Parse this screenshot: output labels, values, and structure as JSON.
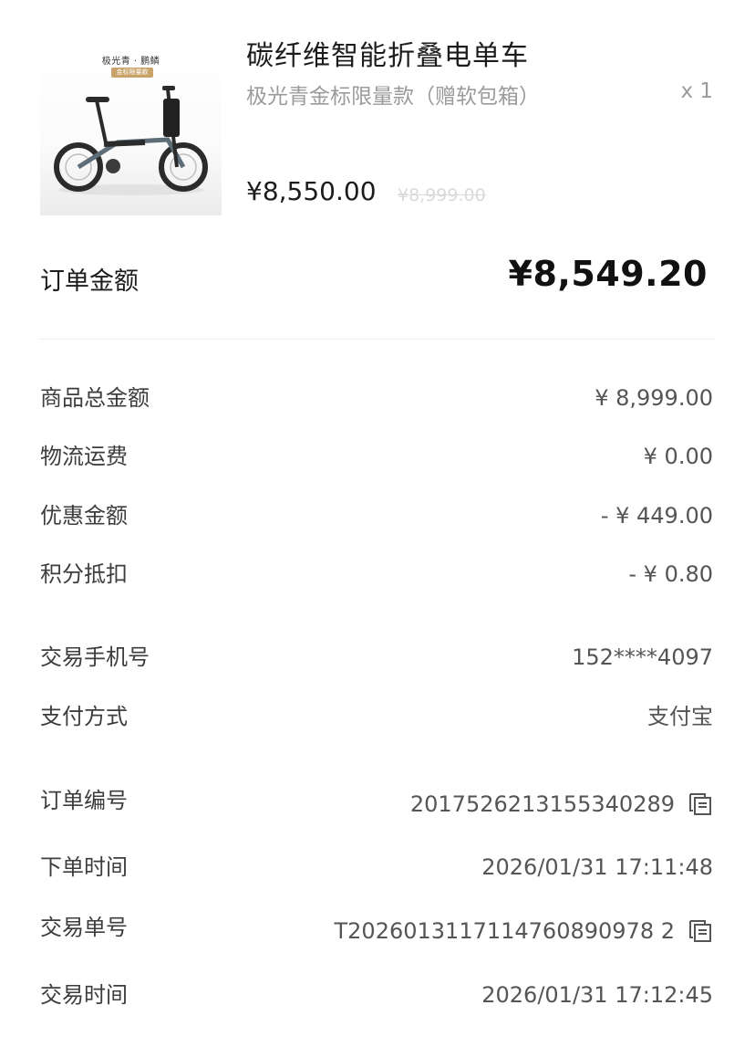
{
  "product": {
    "image_caption": "极光青 · 鹏鳞",
    "image_tag": "金标限量款",
    "title": "碳纤维智能折叠电单车",
    "spec": "极光青金标限量款（赠软包箱）",
    "quantity": "x 1",
    "price": "¥8,550.00",
    "original_price": "¥8,999.00"
  },
  "order_total": {
    "label": "订单金额",
    "value": "¥8,549.20"
  },
  "details": [
    {
      "label": "商品总金额",
      "value": "¥ 8,999.00"
    },
    {
      "label": "物流运费",
      "value": "¥ 0.00"
    },
    {
      "label": "优惠金额",
      "value": "- ¥ 449.00"
    },
    {
      "label": "积分抵扣",
      "value": "- ¥ 0.80"
    },
    {
      "label": "交易手机号",
      "value": "152****4097"
    },
    {
      "label": "支付方式",
      "value": "支付宝"
    },
    {
      "label": "订单编号",
      "value": "2017526213155340289",
      "icon": "copy-icon"
    },
    {
      "label": "下单时间",
      "value": "2026/01/31 17:11:48"
    },
    {
      "label": "交易单号",
      "value": "T2026013117114760890978 2",
      "icon": "copy-icon"
    },
    {
      "label": "交易时间",
      "value": "2026/01/31 17:12:45"
    }
  ]
}
